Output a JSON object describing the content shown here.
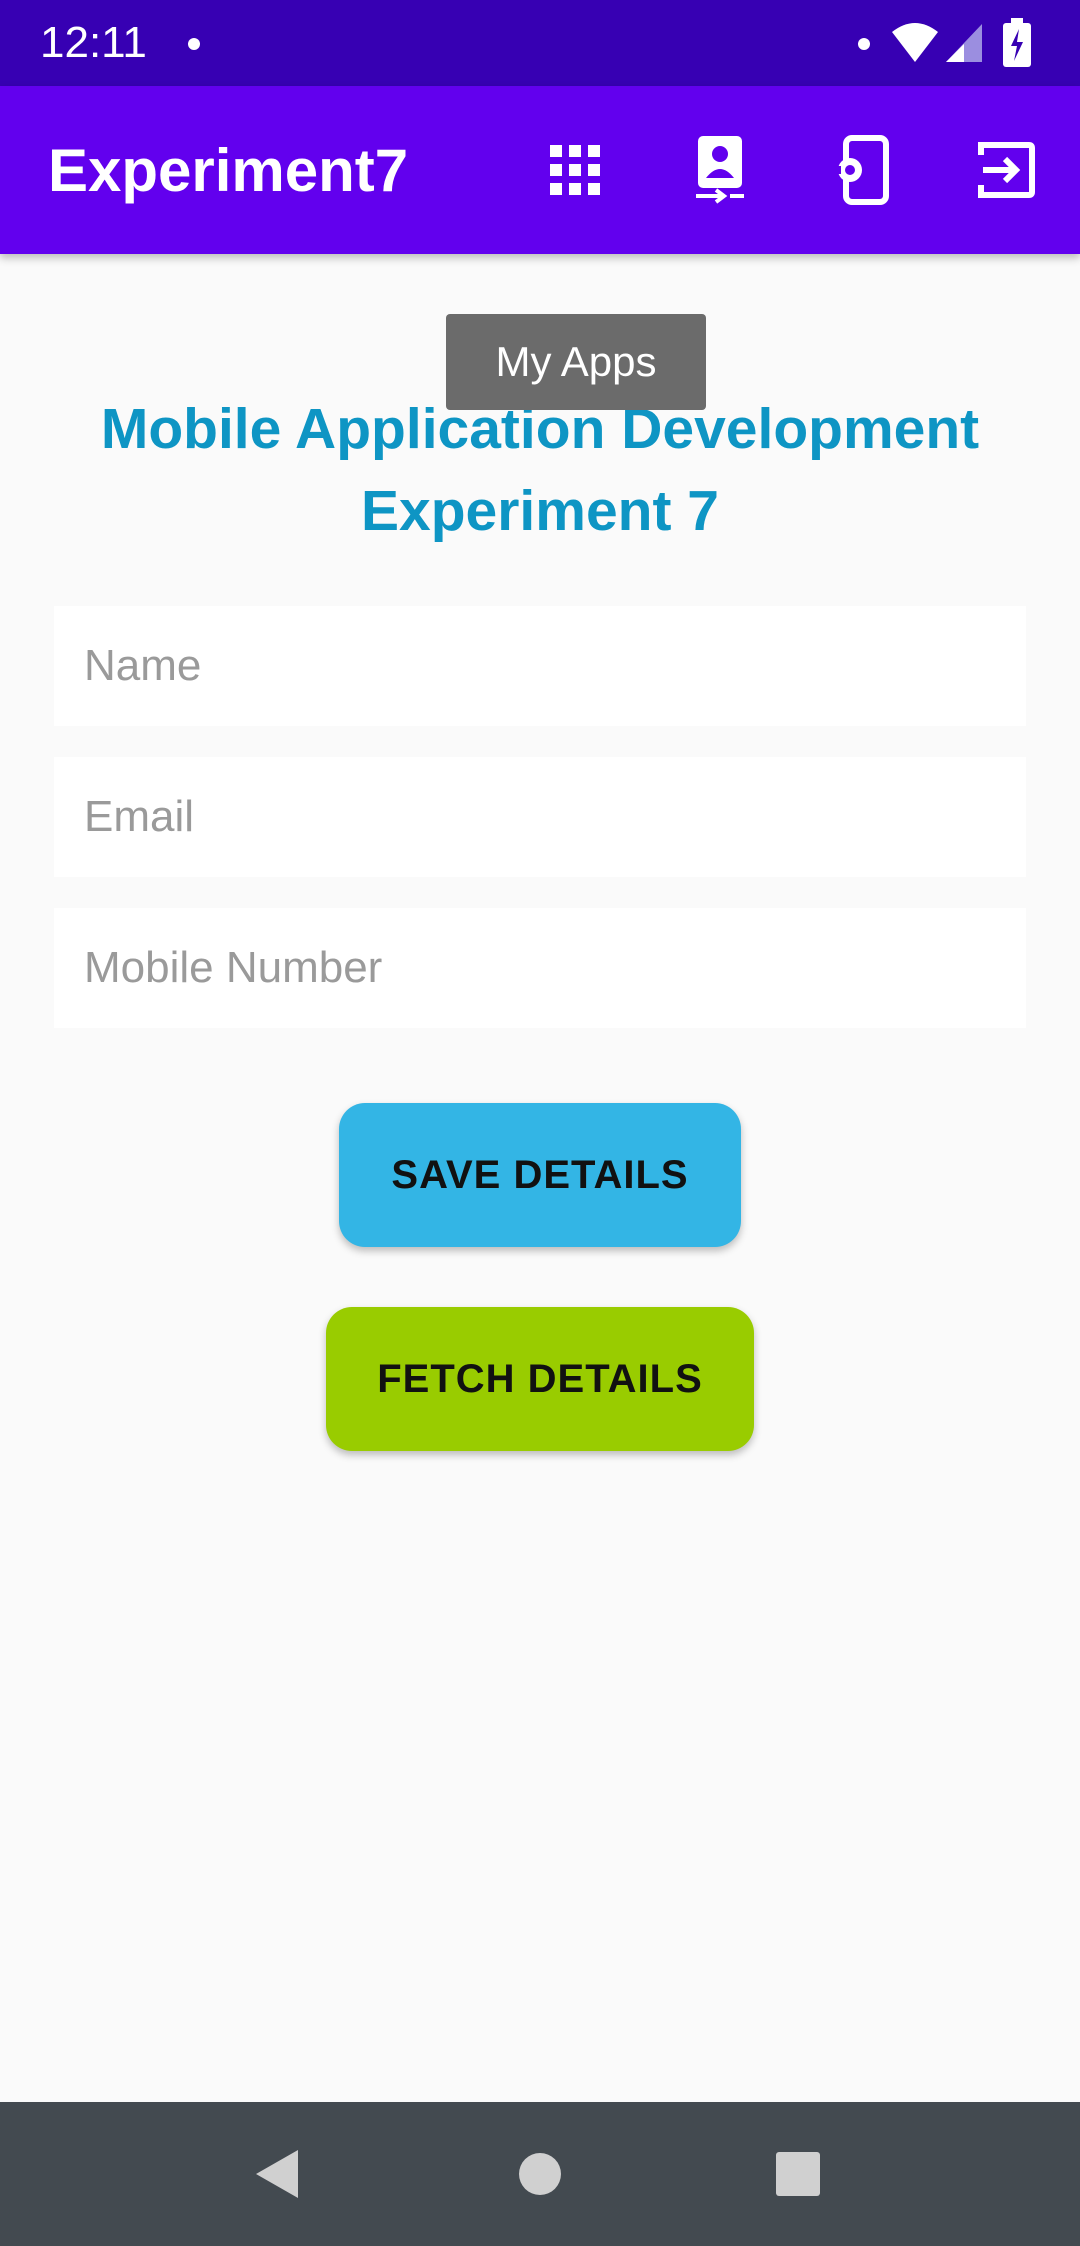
{
  "status_bar": {
    "time": "12:11",
    "icons": [
      "notification-dot-icon",
      "wifi-icon",
      "signal-icon",
      "battery-charging-icon"
    ]
  },
  "app_bar": {
    "title": "Experiment7",
    "actions": [
      {
        "name": "my-apps-icon",
        "tooltip": "My Apps"
      },
      {
        "name": "contact-transfer-icon"
      },
      {
        "name": "device-settings-icon"
      },
      {
        "name": "exit-icon"
      }
    ]
  },
  "tooltip": {
    "text": "My Apps"
  },
  "heading": {
    "line1": "Mobile Application Development",
    "line2": "Experiment 7"
  },
  "form": {
    "name": {
      "placeholder": "Name",
      "value": ""
    },
    "email": {
      "placeholder": "Email",
      "value": ""
    },
    "mobile": {
      "placeholder": "Mobile Number",
      "value": ""
    }
  },
  "buttons": {
    "save_label": "SAVE DETAILS",
    "fetch_label": "FETCH DETAILS"
  },
  "colors": {
    "status_bar": "#3700b3",
    "app_bar": "#6200ee",
    "heading": "#0e95c4",
    "save_button": "#33b5e5",
    "fetch_button": "#99cc00",
    "nav_bar": "#434a50"
  },
  "nav_bar": {
    "buttons": [
      "back-icon",
      "home-icon",
      "recents-icon"
    ]
  }
}
